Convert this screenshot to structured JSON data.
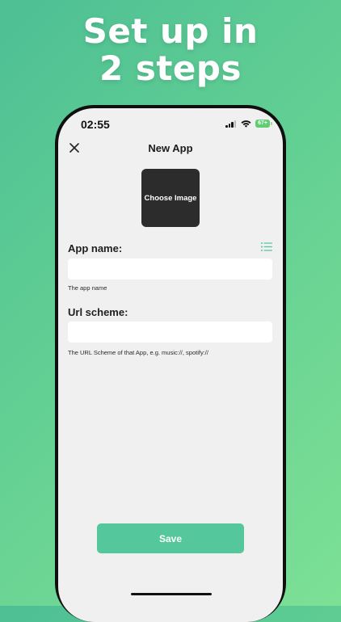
{
  "headline": {
    "line1": "Set up in",
    "line2": "2 steps"
  },
  "status_bar": {
    "time": "02:55",
    "battery": "67+"
  },
  "nav": {
    "title": "New App",
    "close_icon": "close-icon"
  },
  "image_picker": {
    "label": "Choose Image"
  },
  "app_name": {
    "label": "App name:",
    "value": "",
    "placeholder": "",
    "hint": "The app name",
    "list_icon": "list-icon"
  },
  "url_scheme": {
    "label": "Url scheme:",
    "value": "",
    "placeholder": "",
    "hint": "The URL Scheme of that App, e.g. music://, spotify://"
  },
  "actions": {
    "save_label": "Save"
  },
  "colors": {
    "accent": "#54c79d",
    "background": "#f0f0f0",
    "image_tile": "#2c2c2c",
    "battery": "#5fcd72"
  }
}
